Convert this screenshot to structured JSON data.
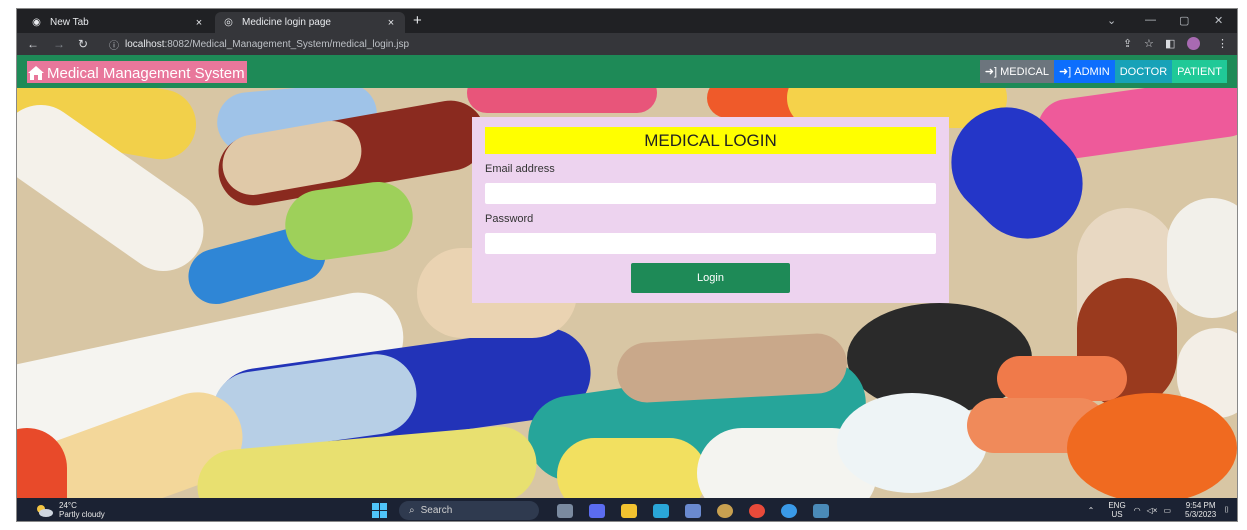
{
  "browser": {
    "tabs": [
      {
        "label": "New Tab",
        "icon": "chrome-icon",
        "active": false
      },
      {
        "label": "Medicine login page",
        "icon": "globe-icon",
        "active": true
      }
    ],
    "close_glyph": "×",
    "new_tab_glyph": "+",
    "url_host": "localhost",
    "url_rest": ":8082/Medical_Management_System/medical_login.jsp"
  },
  "navbar": {
    "brand": "Medical Management System",
    "items": [
      {
        "label": "MEDICAL",
        "icon": "sign-in-icon",
        "color": "#6c757d"
      },
      {
        "label": "ADMIN",
        "icon": "sign-in-icon",
        "color": "#0d6efd"
      },
      {
        "label": "DOCTOR",
        "color": "#17a2b8"
      },
      {
        "label": "PATIENT",
        "color": "#20c997"
      }
    ],
    "color": "#1e8a57"
  },
  "login": {
    "title": "MEDICAL LOGIN",
    "email_label": "Email address",
    "email_value": "",
    "password_label": "Password",
    "password_value": "",
    "button_label": "Login"
  },
  "taskbar": {
    "weather_temp": "24°C",
    "weather_desc": "Partly cloudy",
    "search_label": "Search",
    "lang_top": "ENG",
    "lang_bottom": "US",
    "time": "9:54 PM",
    "date": "5/3/2023"
  }
}
